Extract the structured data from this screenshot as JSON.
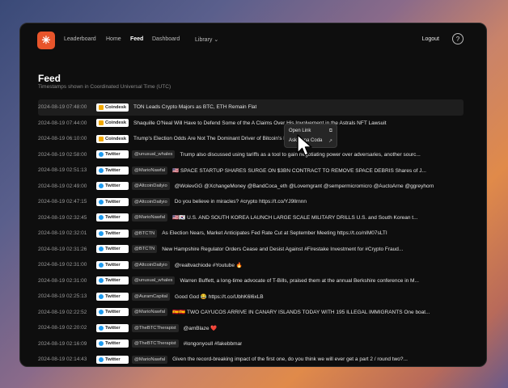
{
  "nav": {
    "logo_glyph": "✳",
    "links": [
      "Leaderboard",
      "Home",
      "Feed",
      "Dashboard",
      "Library ⌄"
    ],
    "logout": "Logout",
    "avatar_glyph": "?"
  },
  "page": {
    "title": "Feed",
    "subtitle": "Timestamps shown in Coordinated Universal Time (UTC)"
  },
  "menu": {
    "items": [
      {
        "label": "Open Link",
        "icon": "external-link-icon",
        "glyph": "⧉"
      },
      {
        "label": "Ask Anna Coda",
        "icon": "sparkle-icon",
        "glyph": "↗"
      }
    ]
  },
  "colors": {
    "accent": "#e8552b",
    "coindesk": "#f2a900",
    "twitter": "#1d9bf0"
  },
  "rows": [
    {
      "ts": "2024-08-19 07:48:00",
      "source": "Coindesk",
      "handle": "",
      "text": "TON Leads Crypto Majors as BTC, ETH Remain Flat"
    },
    {
      "ts": "2024-08-19 07:44:00",
      "source": "Coindesk",
      "handle": "",
      "text": "Shaquille O'Neal Will Have to Defend Some of the A Claims Over His Involvement in the Astrals NFT Lawsuit"
    },
    {
      "ts": "2024-08-19 06:10:00",
      "source": "Coindesk",
      "handle": "",
      "text": "Trump's Election Odds Are Not The Dominant Driver of Bitcoin's Price, Data Show"
    },
    {
      "ts": "2024-08-19 02:58:00",
      "source": "Twitter",
      "handle": "@unusual_whales",
      "text": "Trump also discussed using tariffs as a tool to gain negotiating power over adversaries, another sourc..."
    },
    {
      "ts": "2024-08-19 02:51:13",
      "source": "Twitter",
      "handle": "@MarioNawfal",
      "text": "🇺🇸 SPACE STARTUP SHARES SURGE ON $3BN CONTRACT TO REMOVE SPACE DEBRIS Shares of J..."
    },
    {
      "ts": "2024-08-19 02:49:00",
      "source": "Twitter",
      "handle": "@AltcoinDailyio",
      "text": "@WolevGG @XchangeMoney @BandCoca_eth @Lovemgrant @sempermicromicro @AuctoArne @ggreyhorn"
    },
    {
      "ts": "2024-08-19 02:47:15",
      "source": "Twitter",
      "handle": "@AltcoinDailyio",
      "text": "Do you believe in miracles? #crypto https://t.co/YJ9llrnnn"
    },
    {
      "ts": "2024-08-19 02:32:45",
      "source": "Twitter",
      "handle": "@MarioNawfal",
      "text": "🇺🇸🇰🇷 U.S. AND SOUTH KOREA LAUNCH LARGE SCALE MILITARY DRILLS U.S. and South Korean t..."
    },
    {
      "ts": "2024-08-19 02:32:01",
      "source": "Twitter",
      "handle": "@BTCTN",
      "text": "As Election Nears, Market Anticipates Fed Rate Cut at September Meeting https://t.co/nIM07sLTI"
    },
    {
      "ts": "2024-08-19 02:31:26",
      "source": "Twitter",
      "handle": "@BTCTN",
      "text": "New Hampshire Regulator Orders Cease and Desist Against #Firestake Investment for #Crypto Fraud..."
    },
    {
      "ts": "2024-08-19 02:31:00",
      "source": "Twitter",
      "handle": "@AltcoinDailyio",
      "text": "@realtvachiode #Youtube 🔥"
    },
    {
      "ts": "2024-08-19 02:31:00",
      "source": "Twitter",
      "handle": "@unusual_whales",
      "text": "Warren Buffett, a long-time advocate of T-Bills, praised them at the annual Berkshire conference in M..."
    },
    {
      "ts": "2024-08-19 02:25:13",
      "source": "Twitter",
      "handle": "@AuramCapital",
      "text": "Good God 😂 https://t.co/UbhK6l6xLB"
    },
    {
      "ts": "2024-08-19 02:22:52",
      "source": "Twitter",
      "handle": "@MarioNawfal",
      "text": "🇪🇸🇪🇸 TWO CAYUCOS ARRIVE IN CANARY ISLANDS TODAY WITH 195 ILLEGAL IMMIGRANTS One boat..."
    },
    {
      "ts": "2024-08-19 02:20:02",
      "source": "Twitter",
      "handle": "@TheBTCTherapist",
      "text": "@amBlaze ❤️"
    },
    {
      "ts": "2024-08-19 02:16:09",
      "source": "Twitter",
      "handle": "@TheBTCTherapist",
      "text": "#longonyoull #fakebbmar"
    },
    {
      "ts": "2024-08-19 02:14:43",
      "source": "Twitter",
      "handle": "@MarioNawfal",
      "text": "Given the record-breaking impact of the first one, do you think we will ever get a part 2 / round two?..."
    }
  ]
}
